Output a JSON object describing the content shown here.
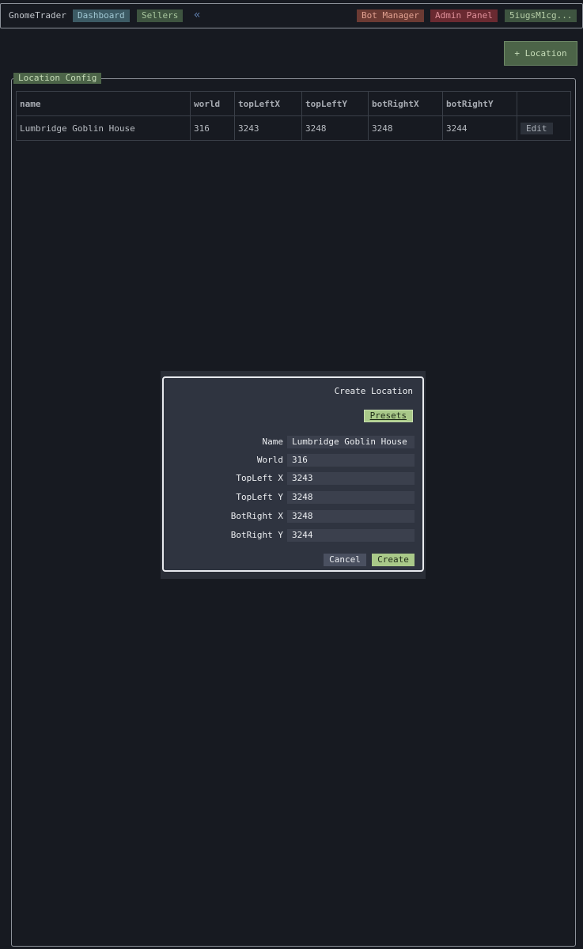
{
  "nav": {
    "brand": "GnomeTrader",
    "dashboard": "Dashboard",
    "sellers": "Sellers",
    "collapse": "«",
    "bot_manager": "Bot Manager",
    "admin_panel": "Admin Panel",
    "user": "5iugsM1cg..."
  },
  "toolbar": {
    "add_location": "+ Location"
  },
  "panel": {
    "legend": "Location Config"
  },
  "table": {
    "headers": [
      "name",
      "world",
      "topLeftX",
      "topLeftY",
      "botRightX",
      "botRightY",
      ""
    ],
    "rows": [
      {
        "name": "Lumbridge Goblin House",
        "world": "316",
        "topLeftX": "3243",
        "topLeftY": "3248",
        "botRightX": "3248",
        "botRightY": "3244",
        "action": "Edit"
      }
    ]
  },
  "modal": {
    "title": "Create Location",
    "presets": "Presets",
    "fields": {
      "name_label": "Name",
      "name_value": "Lumbridge Goblin House",
      "world_label": "World",
      "world_value": "316",
      "tlx_label": "TopLeft X",
      "tlx_value": "3243",
      "tly_label": "TopLeft Y",
      "tly_value": "3248",
      "brx_label": "BotRight X",
      "brx_value": "3248",
      "bry_label": "BotRight Y",
      "bry_value": "3244"
    },
    "cancel": "Cancel",
    "create": "Create"
  },
  "colors": {
    "background": "#171a21",
    "accent_green": "#a9c989",
    "dashboard_blue": "#3c5a64",
    "bot_manager_red": "#6b3a33",
    "admin_red": "#6a2a31"
  }
}
